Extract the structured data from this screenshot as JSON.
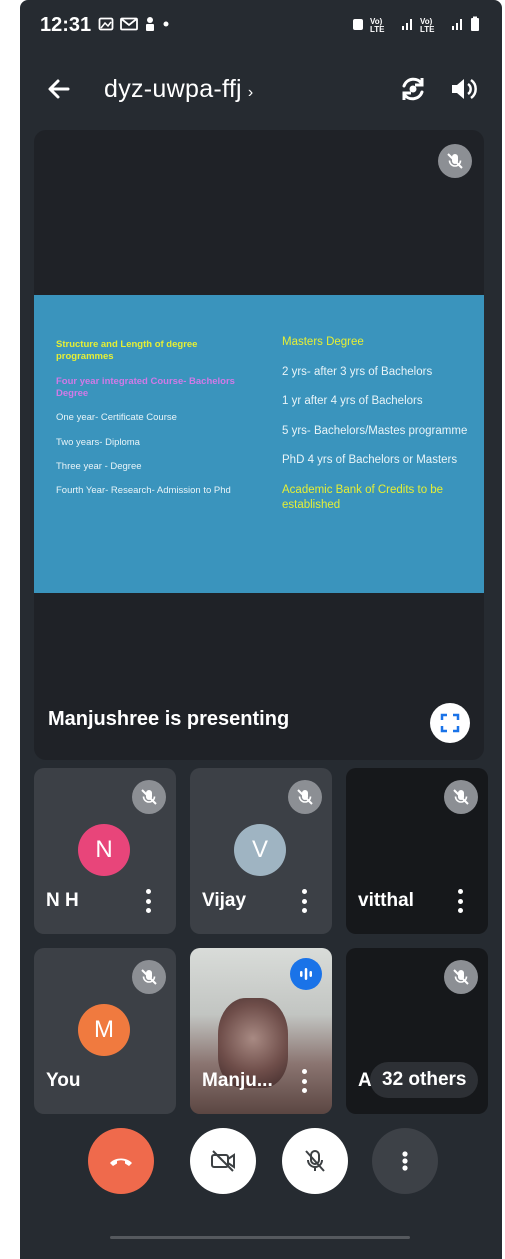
{
  "status_bar": {
    "time": "12:31",
    "left_icons": [
      "gallery-icon",
      "gmail-icon",
      "person-icon",
      "dot-icon"
    ],
    "right_text": [
      "Vo) LTE",
      "LTE1",
      "Vo) LTE",
      "LTE2"
    ]
  },
  "header": {
    "meeting_code": "dyz-uwpa-ffj",
    "chevron": "›"
  },
  "presentation": {
    "presenting_label": "Manjushree is presenting",
    "slide": {
      "left_title": "Structure and Length of degree programmes",
      "left_subtitle": "Four year integrated Course- Bachelors Degree",
      "left_items": [
        "One year- Certificate Course",
        "Two years- Diploma",
        "Three year - Degree",
        "Fourth Year- Research- Admission to Phd"
      ],
      "right_title": "Masters Degree",
      "right_items": [
        "2 yrs- after 3 yrs of Bachelors",
        "1 yr after  4 yrs of Bachelors",
        "5 yrs- Bachelors/Mastes programme",
        "PhD 4 yrs of Bachelors or Masters"
      ],
      "right_footer": "Academic Bank of Credits to be established"
    }
  },
  "participants": [
    {
      "name": "N H",
      "initial": "N",
      "avatar_color": "#e8457a"
    },
    {
      "name": "Vijay",
      "initial": "V",
      "avatar_color": "#9fb4c2"
    },
    {
      "name": "vitthal"
    },
    {
      "name": "You",
      "initial": "M",
      "avatar_color": "#f07a3f"
    },
    {
      "name": "Manju..."
    },
    {
      "name": "An",
      "others_label": "32 others"
    }
  ],
  "colors": {
    "background": "#262b31",
    "end_call": "#ef6a4c",
    "speaking": "#1a73e8",
    "slide_bg": "#3a94bd",
    "slide_yellow": "#e6ef35"
  }
}
